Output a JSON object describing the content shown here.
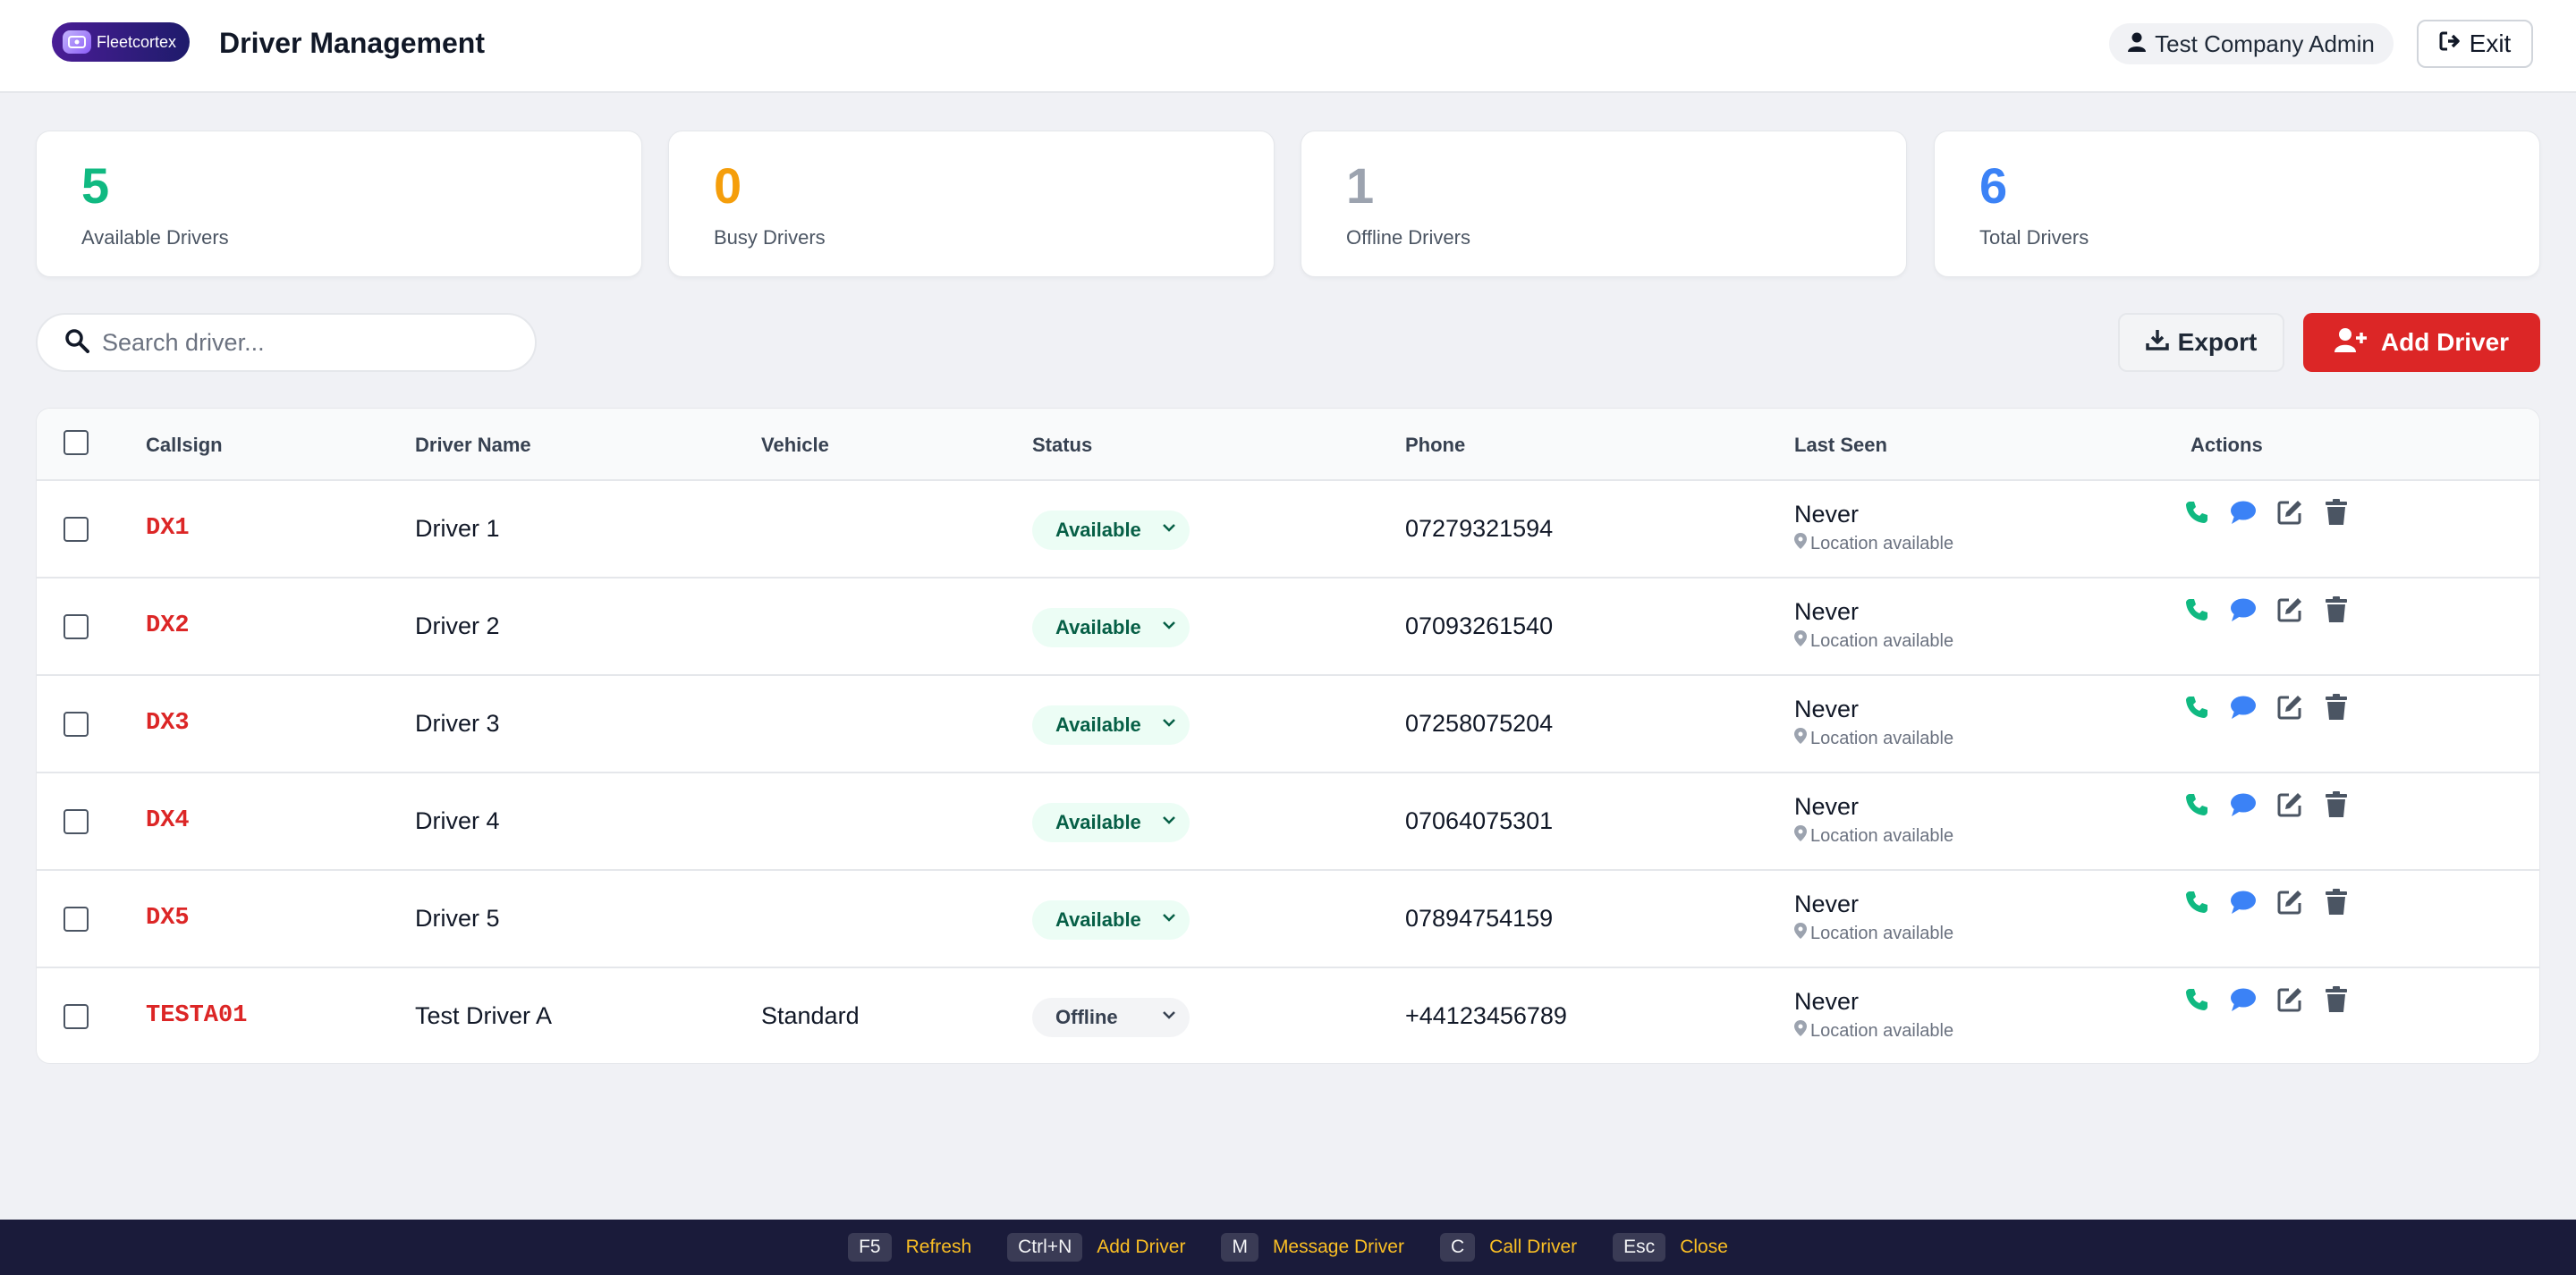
{
  "header": {
    "logo_text": "Fleetcortex",
    "title": "Driver Management",
    "user_label": "Test Company Admin",
    "exit_label": "Exit"
  },
  "stats": [
    {
      "value": "5",
      "label": "Available Drivers",
      "color": "#10b981"
    },
    {
      "value": "0",
      "label": "Busy Drivers",
      "color": "#f59e0b"
    },
    {
      "value": "1",
      "label": "Offline Drivers",
      "color": "#9ca3af"
    },
    {
      "value": "6",
      "label": "Total Drivers",
      "color": "#3b82f6"
    }
  ],
  "toolbar": {
    "search_placeholder": "Search driver...",
    "search_value": "",
    "export_label": "Export",
    "add_label": "Add Driver"
  },
  "table": {
    "columns": [
      "Callsign",
      "Driver Name",
      "Vehicle",
      "Status",
      "Phone",
      "Last Seen",
      "Actions"
    ],
    "rows": [
      {
        "callsign": "DX1",
        "name": "Driver 1",
        "vehicle": "",
        "status": "Available",
        "phone": "07279321594",
        "last_seen": "Never",
        "location": "Location available"
      },
      {
        "callsign": "DX2",
        "name": "Driver 2",
        "vehicle": "",
        "status": "Available",
        "phone": "07093261540",
        "last_seen": "Never",
        "location": "Location available"
      },
      {
        "callsign": "DX3",
        "name": "Driver 3",
        "vehicle": "",
        "status": "Available",
        "phone": "07258075204",
        "last_seen": "Never",
        "location": "Location available"
      },
      {
        "callsign": "DX4",
        "name": "Driver 4",
        "vehicle": "",
        "status": "Available",
        "phone": "07064075301",
        "last_seen": "Never",
        "location": "Location available"
      },
      {
        "callsign": "DX5",
        "name": "Driver 5",
        "vehicle": "",
        "status": "Available",
        "phone": "07894754159",
        "last_seen": "Never",
        "location": "Location available"
      },
      {
        "callsign": "TESTA01",
        "name": "Test Driver A",
        "vehicle": "Standard",
        "status": "Offline",
        "phone": "+44123456789",
        "last_seen": "Never",
        "location": "Location available"
      }
    ]
  },
  "footer": {
    "shortcuts": [
      {
        "key": "F5",
        "label": "Refresh"
      },
      {
        "key": "Ctrl+N",
        "label": "Add Driver"
      },
      {
        "key": "M",
        "label": "Message Driver"
      },
      {
        "key": "C",
        "label": "Call Driver"
      },
      {
        "key": "Esc",
        "label": "Close"
      }
    ]
  },
  "colors": {
    "accent_red": "#dc2626",
    "call_green": "#10b981",
    "message_blue": "#3b82f6",
    "icon_gray": "#4b5563",
    "footer_bg": "#1a1b3a"
  }
}
